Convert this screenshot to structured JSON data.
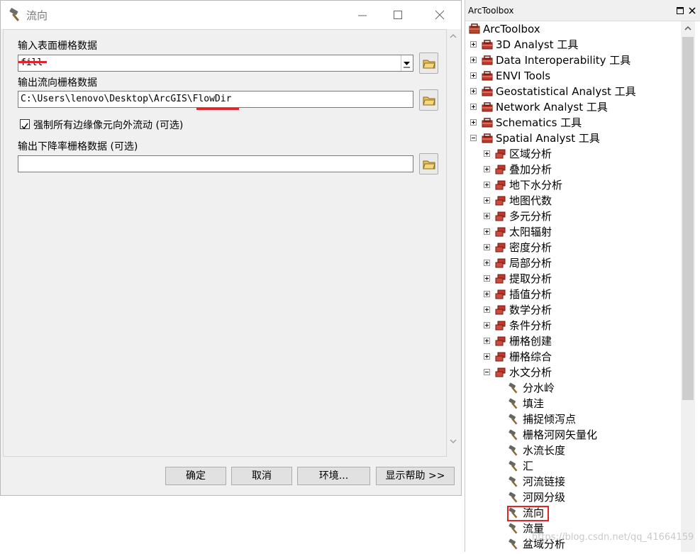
{
  "dialog": {
    "title": "流向",
    "input_label": "输入表面栅格数据",
    "input_value": "fill",
    "output_label": "输出流向栅格数据",
    "output_value": "C:\\Users\\lenovo\\Desktop\\ArcGIS\\FlowDir",
    "force_label": "强制所有边缘像元向外流动 (可选)",
    "force_checked": true,
    "drop_label": "输出下降率栅格数据 (可选)",
    "drop_value": "",
    "buttons": {
      "ok": "确定",
      "cancel": "取消",
      "env": "环境...",
      "help": "显示帮助 >>"
    }
  },
  "arctoolbox": {
    "title": "ArcToolbox",
    "root": "ArcToolbox",
    "toolboxes": [
      "3D Analyst 工具",
      "Data Interoperability 工具",
      "ENVI Tools",
      "Geostatistical Analyst 工具",
      "Network Analyst 工具",
      "Schematics 工具",
      "Spatial Analyst 工具"
    ],
    "spatial_analyst_toolsets": [
      "区域分析",
      "叠加分析",
      "地下水分析",
      "地图代数",
      "多元分析",
      "太阳辐射",
      "密度分析",
      "局部分析",
      "提取分析",
      "插值分析",
      "数学分析",
      "条件分析",
      "栅格创建",
      "栅格综合",
      "水文分析"
    ],
    "hydrology_tools": [
      "分水岭",
      "填洼",
      "捕捉倾泻点",
      "栅格河网矢量化",
      "水流长度",
      "汇",
      "河流链接",
      "河网分级",
      "流向",
      "流量",
      "盆域分析"
    ],
    "selected_tool": "流向"
  },
  "watermark": "https://blog.csdn.net/qq_41664159",
  "colors": {
    "accent_red": "#e0242a",
    "toolbox_red": "#c0392b"
  }
}
